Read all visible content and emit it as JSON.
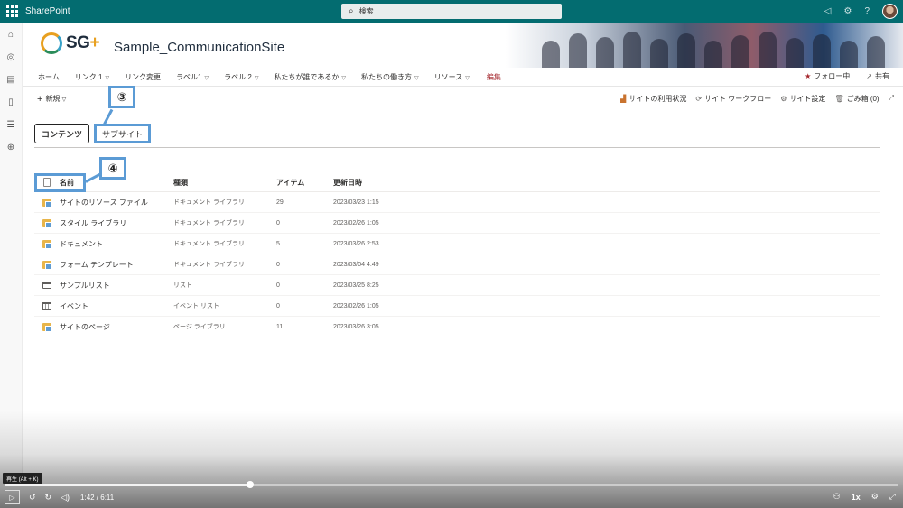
{
  "suite": {
    "app_name": "SharePoint",
    "search_placeholder": "検索"
  },
  "header": {
    "logo_text": "SG",
    "logo_plus": "+",
    "site_title": "Sample_CommunicationSite"
  },
  "nav": {
    "items": [
      {
        "label": "ホーム",
        "chevron": false
      },
      {
        "label": "リンク 1",
        "chevron": true
      },
      {
        "label": "リンク変更",
        "chevron": false
      },
      {
        "label": "ラベル1",
        "chevron": true
      },
      {
        "label": "ラベル 2",
        "chevron": true
      },
      {
        "label": "私たちが誰であるか",
        "chevron": true
      },
      {
        "label": "私たちの働き方",
        "chevron": true
      },
      {
        "label": "リソース",
        "chevron": true
      }
    ],
    "edit_label": "編集",
    "follow_label": "フォロー中",
    "share_label": "共有"
  },
  "commandbar": {
    "new_label": "新規",
    "site_usage": "サイトの利用状況",
    "site_workflow": "サイト ワークフロー",
    "site_settings": "サイト設定",
    "recycle_bin": "ごみ箱 (0)"
  },
  "tabs": {
    "contents": "コンテンツ",
    "subsites": "サブサイト"
  },
  "callouts": {
    "c3": "③",
    "c4": "④"
  },
  "table": {
    "headers": {
      "name": "名前",
      "type": "種類",
      "items": "アイテム",
      "modified": "更新日時"
    },
    "rows": [
      {
        "icon": "library-icon",
        "name": "サイトのリソース ファイル",
        "type": "ドキュメント ライブラリ",
        "items": "29",
        "modified": "2023/03/23 1:15"
      },
      {
        "icon": "library-icon",
        "name": "スタイル ライブラリ",
        "type": "ドキュメント ライブラリ",
        "items": "0",
        "modified": "2023/02/26 1:05"
      },
      {
        "icon": "library-icon",
        "name": "ドキュメント",
        "type": "ドキュメント ライブラリ",
        "items": "5",
        "modified": "2023/03/26 2:53"
      },
      {
        "icon": "library-icon",
        "name": "フォーム テンプレート",
        "type": "ドキュメント ライブラリ",
        "items": "0",
        "modified": "2023/03/04 4:49"
      },
      {
        "icon": "list-icon",
        "name": "サンプルリスト",
        "type": "リスト",
        "items": "0",
        "modified": "2023/03/25 8:25"
      },
      {
        "icon": "calendar-icon",
        "name": "イベント",
        "type": "イベント リスト",
        "items": "0",
        "modified": "2023/02/26 1:05"
      },
      {
        "icon": "library-icon",
        "name": "サイトのページ",
        "type": "ページ ライブラリ",
        "items": "11",
        "modified": "2023/03/26 3:05"
      }
    ]
  },
  "player": {
    "tooltip": "再生 (Alt + K)",
    "time": "1:42 / 6:11",
    "progress": 0.275,
    "speed": "1x"
  }
}
